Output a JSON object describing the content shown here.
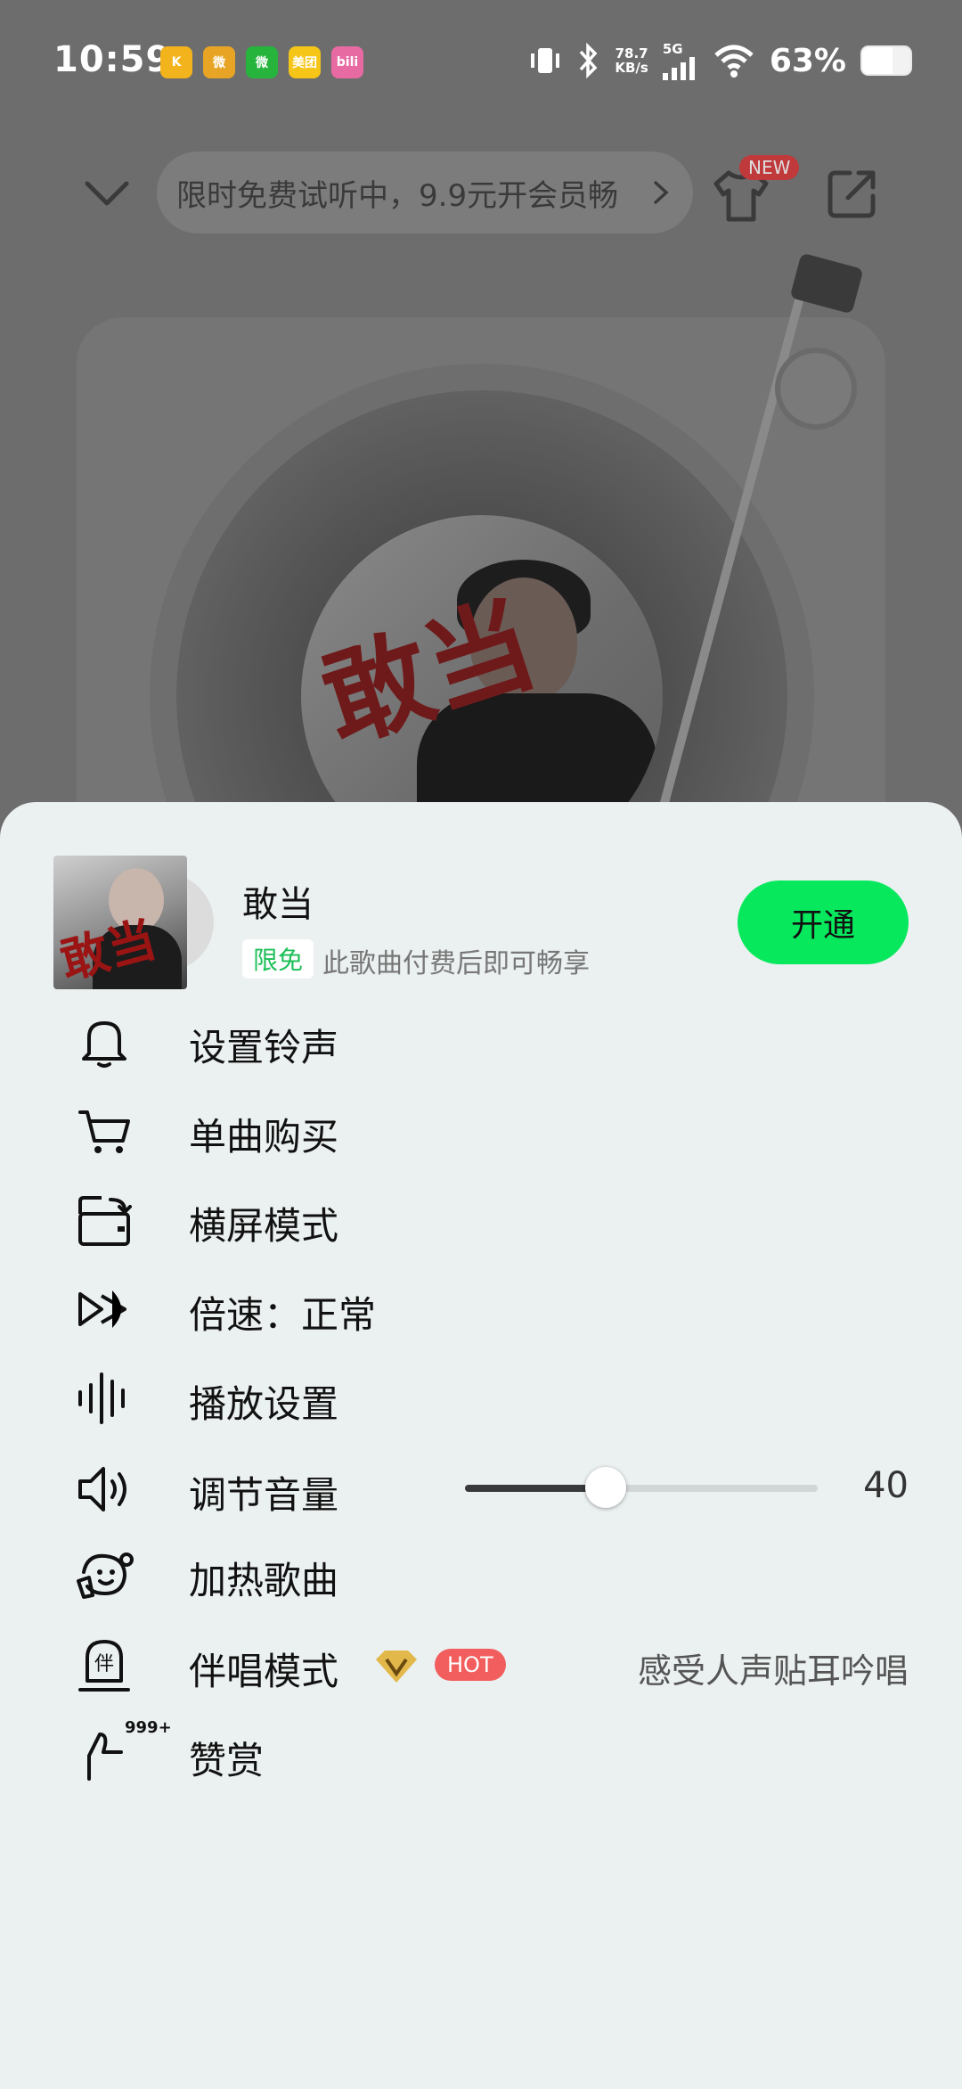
{
  "status_bar": {
    "time": "10:59",
    "app_icons": [
      {
        "name": "kugou-icon",
        "text": "K",
        "color": "#f2b31c"
      },
      {
        "name": "weibo-icon",
        "text": "微",
        "color": "#e8a525"
      },
      {
        "name": "wechat-icon",
        "text": "微",
        "color": "#27b43d"
      },
      {
        "name": "meituan-icon",
        "text": "美团",
        "color": "#f5c518"
      },
      {
        "name": "bilibili-icon",
        "text": "bili",
        "color": "#e86aa3"
      }
    ],
    "net_speed_value": "78.7",
    "net_speed_unit": "KB/s",
    "network": "5G",
    "battery": "63%",
    "battery_level": 0.63
  },
  "header": {
    "promo_text": "限时免费试听中，9.9元开会员畅",
    "new_badge": "NEW"
  },
  "song": {
    "title": "敢当",
    "free_tag": "限免",
    "subtitle": "此歌曲付费后即可畅享",
    "open_button": "开通",
    "cover_title": "敢当"
  },
  "menu": {
    "ringtone": "设置铃声",
    "buy": "单曲购买",
    "landscape": "横屏模式",
    "speed": "倍速：正常",
    "playback_settings": "播放设置",
    "volume": "调节音量",
    "volume_value": "40",
    "volume_level": 0.4,
    "boost": "加热歌曲",
    "accompany": "伴唱模式",
    "accompany_hot": "HOT",
    "accompany_desc": "感受人声贴耳吟唱",
    "like_count": "999+",
    "like": "赞赏"
  },
  "colors": {
    "accent_green": "#07e85d",
    "free_green": "#1cbf57",
    "hot_red": "#f25d5d",
    "sheet_bg": "#ebf0f0"
  }
}
